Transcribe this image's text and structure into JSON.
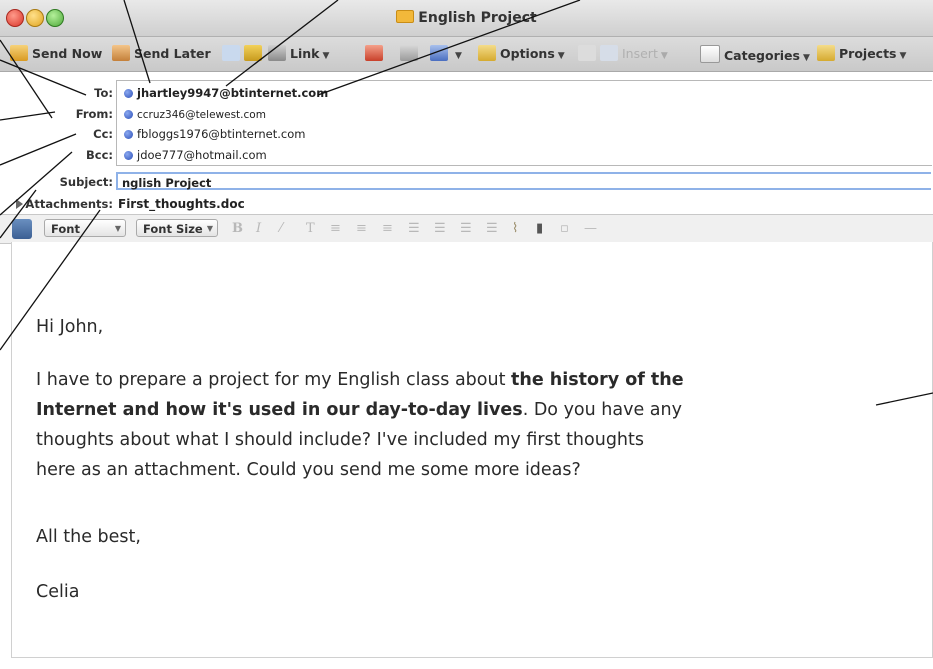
{
  "window": {
    "title": "English Project"
  },
  "toolbar": {
    "send_now": "Send Now",
    "send_later": "Send Later",
    "link": "Link",
    "options": "Options",
    "insert": "Insert",
    "categories": "Categories",
    "projects": "Projects"
  },
  "headers": {
    "to_label": "To:",
    "from_label": "From:",
    "cc_label": "Cc:",
    "bcc_label": "Bcc:",
    "subject_label": "Subject:",
    "attachments_label": "Attachments:",
    "to_value": "jhartley9947@btinternet.com",
    "from_value": "ccruz346@telewest.com",
    "cc_value": "fbloggs1976@btinternet.com",
    "bcc_value": "jdoe777@hotmail.com",
    "subject_value": "nglish Project",
    "attachment_value": "First_thoughts.doc"
  },
  "format": {
    "font": "Font",
    "font_size": "Font Size"
  },
  "message": {
    "greeting": "Hi John,",
    "p1_a": "I have to prepare a project for my English class about ",
    "p1_bold": "the history of the",
    "p1_b_bold": "Internet and how it's used in our day-to-day lives",
    "p1_b": ". Do you have any",
    "p1_c": "thoughts about what I should include? I've included my first thoughts",
    "p1_d": "here as an attachment. Could you send me some more ideas?",
    "closing": "All the best,",
    "signature": "Celia"
  }
}
